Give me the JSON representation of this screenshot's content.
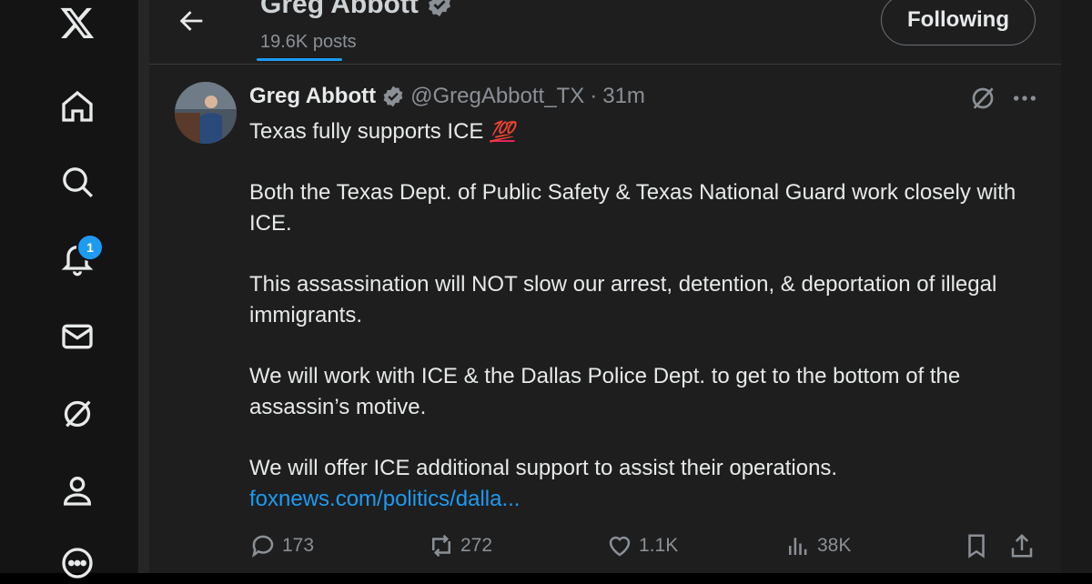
{
  "nav": {
    "items": [
      {
        "name": "x-logo-icon"
      },
      {
        "name": "home-icon"
      },
      {
        "name": "search-icon"
      },
      {
        "name": "notifications-icon",
        "badge": "1"
      },
      {
        "name": "messages-icon"
      },
      {
        "name": "grok-icon"
      },
      {
        "name": "profile-icon"
      },
      {
        "name": "more-icon"
      }
    ]
  },
  "header": {
    "name": "Greg Abbott",
    "posts": "19.6K posts",
    "follow_label": "Following"
  },
  "tweet": {
    "name": "Greg Abbott",
    "handle": "@GregAbbott_TX",
    "separator": "·",
    "time": "31m",
    "line1": "Texas fully supports ICE",
    "emoji": "💯",
    "para2": "Both the Texas Dept. of Public Safety & Texas National Guard work closely with ICE.",
    "para3": "This assassination will NOT slow our arrest, detention, & deportation of illegal immigrants.",
    "para4": "We will work with ICE & the Dallas Police Dept. to get to the bottom of the assassin’s motive.",
    "para5": "We will offer ICE additional support to assist their operations.",
    "link": "foxnews.com/politics/dalla..."
  },
  "actions": {
    "replies": "173",
    "reposts": "272",
    "likes": "1.1K",
    "views": "38K"
  },
  "colors": {
    "accent": "#1d9bf0",
    "background": "#1e1e1e",
    "text": "#e7e9ea",
    "muted": "#8b9096"
  }
}
